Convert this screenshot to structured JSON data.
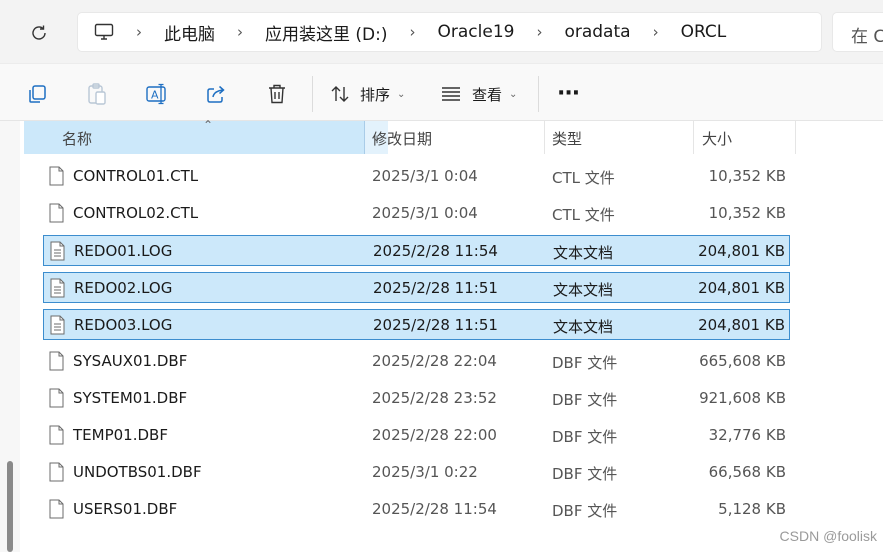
{
  "address_bar": {
    "crumbs": [
      "此电脑",
      "应用装这里 (D:)",
      "Oracle19",
      "oradata",
      "ORCL"
    ],
    "separator": "›"
  },
  "search": {
    "placeholder": "在 ORCL 中搜索",
    "visible_text": "在 C"
  },
  "toolbar": {
    "buttons": [
      {
        "icon": "copy-icon"
      },
      {
        "icon": "paste-icon"
      },
      {
        "icon": "rename-icon"
      },
      {
        "icon": "share-icon"
      },
      {
        "icon": "delete-icon"
      }
    ],
    "sort_label": "排序",
    "view_label": "查看",
    "more_label": "···"
  },
  "columns": {
    "name": "名称",
    "date": "修改日期",
    "type": "类型",
    "size": "大小"
  },
  "files": [
    {
      "name": "CONTROL01.CTL",
      "date": "2025/3/1 0:04",
      "type": "CTL 文件",
      "size": "10,352 KB",
      "selected": false
    },
    {
      "name": "CONTROL02.CTL",
      "date": "2025/3/1 0:04",
      "type": "CTL 文件",
      "size": "10,352 KB",
      "selected": false
    },
    {
      "name": "REDO01.LOG",
      "date": "2025/2/28 11:54",
      "type": "文本文档",
      "size": "204,801 KB",
      "selected": true
    },
    {
      "name": "REDO02.LOG",
      "date": "2025/2/28 11:51",
      "type": "文本文档",
      "size": "204,801 KB",
      "selected": true
    },
    {
      "name": "REDO03.LOG",
      "date": "2025/2/28 11:51",
      "type": "文本文档",
      "size": "204,801 KB",
      "selected": true
    },
    {
      "name": "SYSAUX01.DBF",
      "date": "2025/2/28 22:04",
      "type": "DBF 文件",
      "size": "665,608 KB",
      "selected": false
    },
    {
      "name": "SYSTEM01.DBF",
      "date": "2025/2/28 23:52",
      "type": "DBF 文件",
      "size": "921,608 KB",
      "selected": false
    },
    {
      "name": "TEMP01.DBF",
      "date": "2025/2/28 22:00",
      "type": "DBF 文件",
      "size": "32,776 KB",
      "selected": false
    },
    {
      "name": "UNDOTBS01.DBF",
      "date": "2025/3/1 0:22",
      "type": "DBF 文件",
      "size": "66,568 KB",
      "selected": false
    },
    {
      "name": "USERS01.DBF",
      "date": "2025/2/28 11:54",
      "type": "DBF 文件",
      "size": "5,128 KB",
      "selected": false
    }
  ],
  "watermark": "CSDN @foolisk",
  "colors": {
    "selection_bg": "#cce8fa",
    "selection_border": "#3c8dce"
  }
}
